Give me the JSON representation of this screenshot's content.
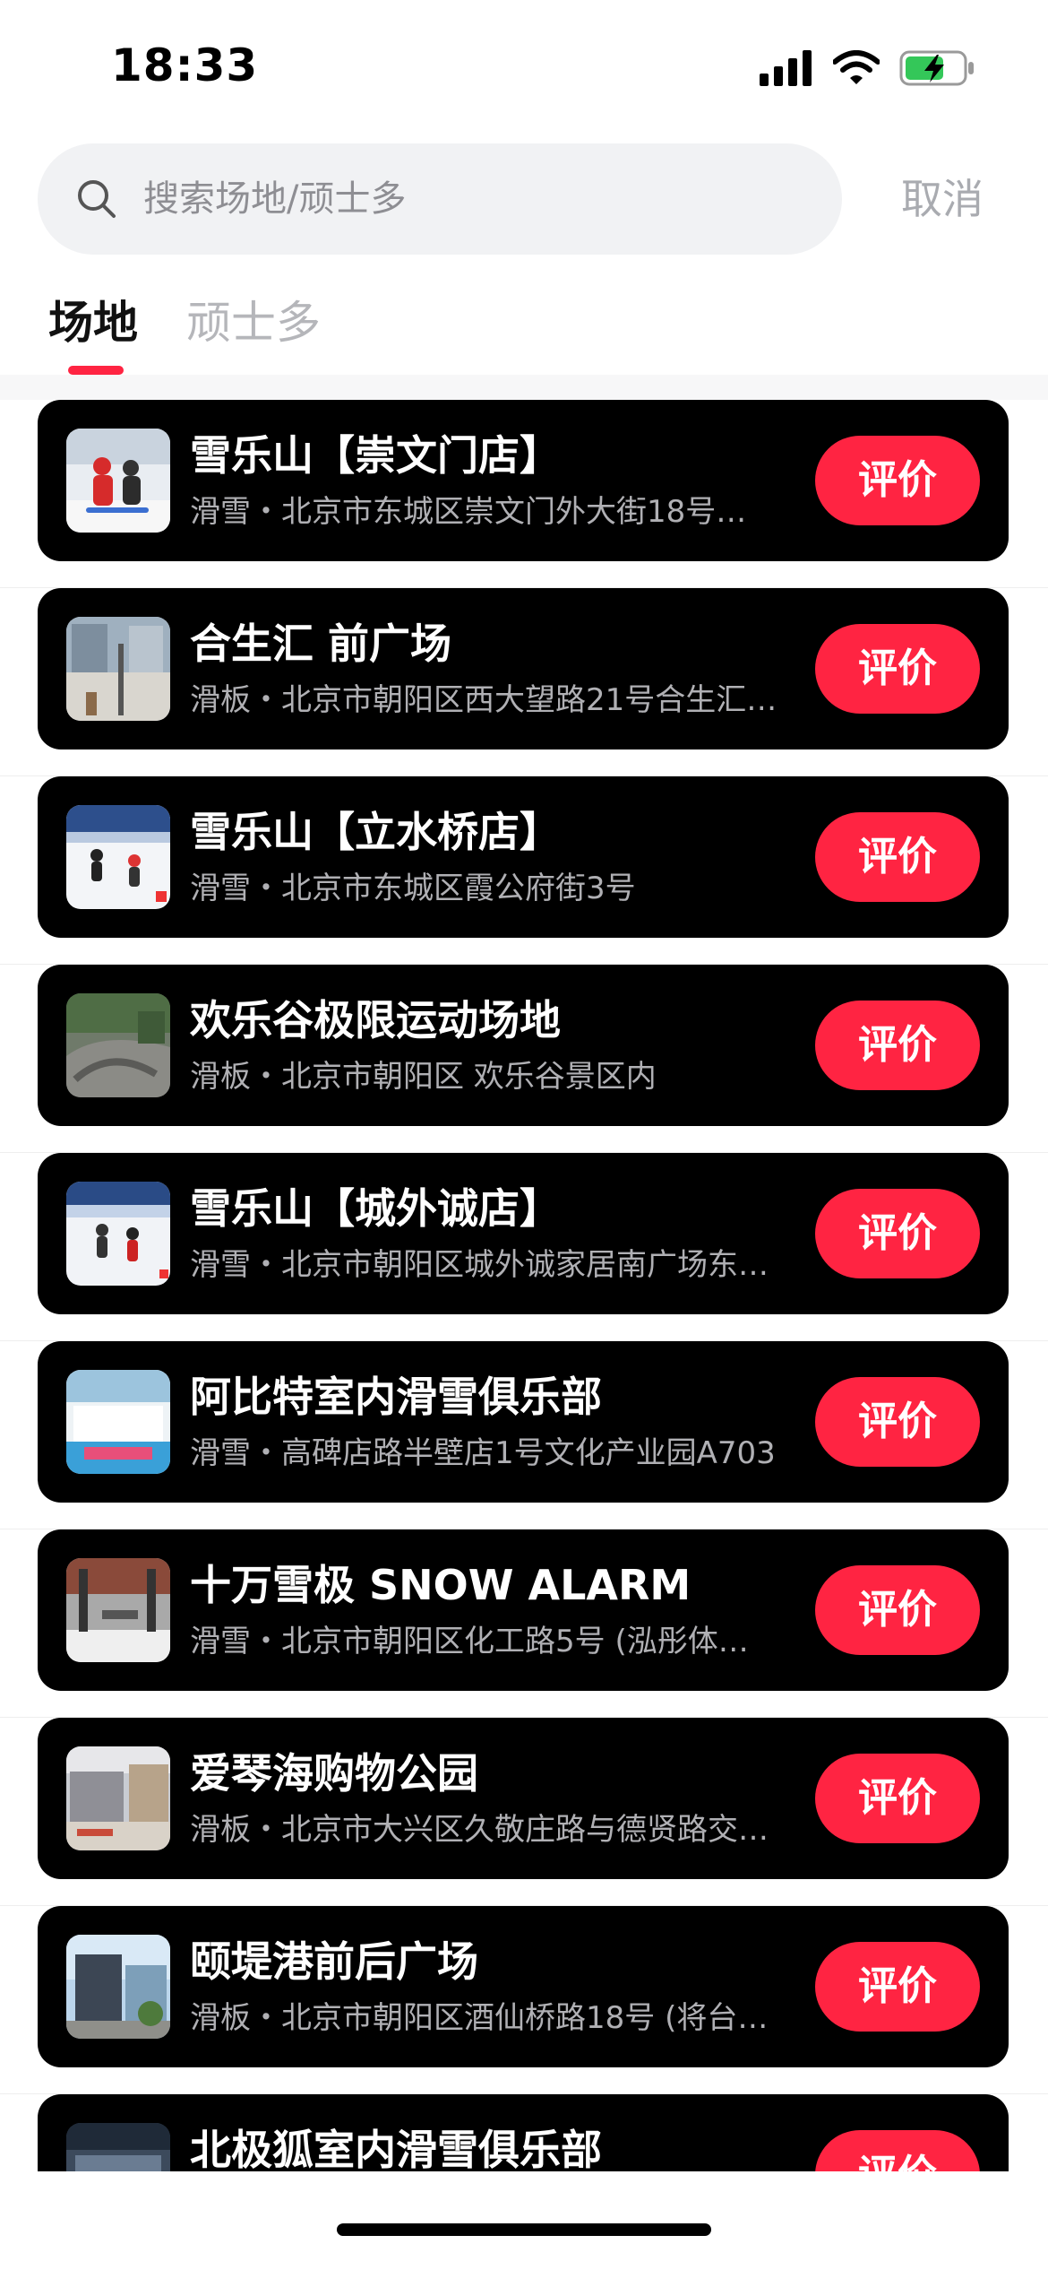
{
  "status_bar": {
    "time": "18:33"
  },
  "search": {
    "placeholder": "搜索场地/顽士多",
    "value": "",
    "cancel_label": "取消"
  },
  "tabs": [
    {
      "label": "场地",
      "active": true
    },
    {
      "label": "顽士多",
      "active": false
    }
  ],
  "colors": {
    "accent": "#ff2442",
    "card_bg": "#000000"
  },
  "venues": [
    {
      "name": "雪乐山【崇文门店】",
      "desc": "滑雪・北京市东城区崇文门外大街18号…",
      "action_label": "评价"
    },
    {
      "name": "合生汇 前广场",
      "desc": "滑板・北京市朝阳区西大望路21号合生汇…",
      "action_label": "评价"
    },
    {
      "name": "雪乐山【立水桥店】",
      "desc": "滑雪・北京市东城区霞公府街3号",
      "action_label": "评价"
    },
    {
      "name": "欢乐谷极限运动场地",
      "desc": "滑板・北京市朝阳区 欢乐谷景区内",
      "action_label": "评价"
    },
    {
      "name": "雪乐山【城外诚店】",
      "desc": "滑雪・北京市朝阳区城外诚家居南广场东…",
      "action_label": "评价"
    },
    {
      "name": "阿比特室内滑雪俱乐部",
      "desc": "滑雪・高碑店路半壁店1号文化产业园A703",
      "action_label": "评价"
    },
    {
      "name": "十万雪极 SNOW ALARM",
      "desc": "滑雪・北京市朝阳区化工路5号 (泓彤体…",
      "action_label": "评价"
    },
    {
      "name": "爱琴海购物公园",
      "desc": "滑板・北京市大兴区久敬庄路与德贤路交…",
      "action_label": "评价"
    },
    {
      "name": "颐堤港前后广场",
      "desc": "滑板・北京市朝阳区酒仙桥路18号 (将台…",
      "action_label": "评价"
    },
    {
      "name": "北极狐室内滑雪俱乐部",
      "desc": "",
      "action_label": "评价"
    }
  ]
}
